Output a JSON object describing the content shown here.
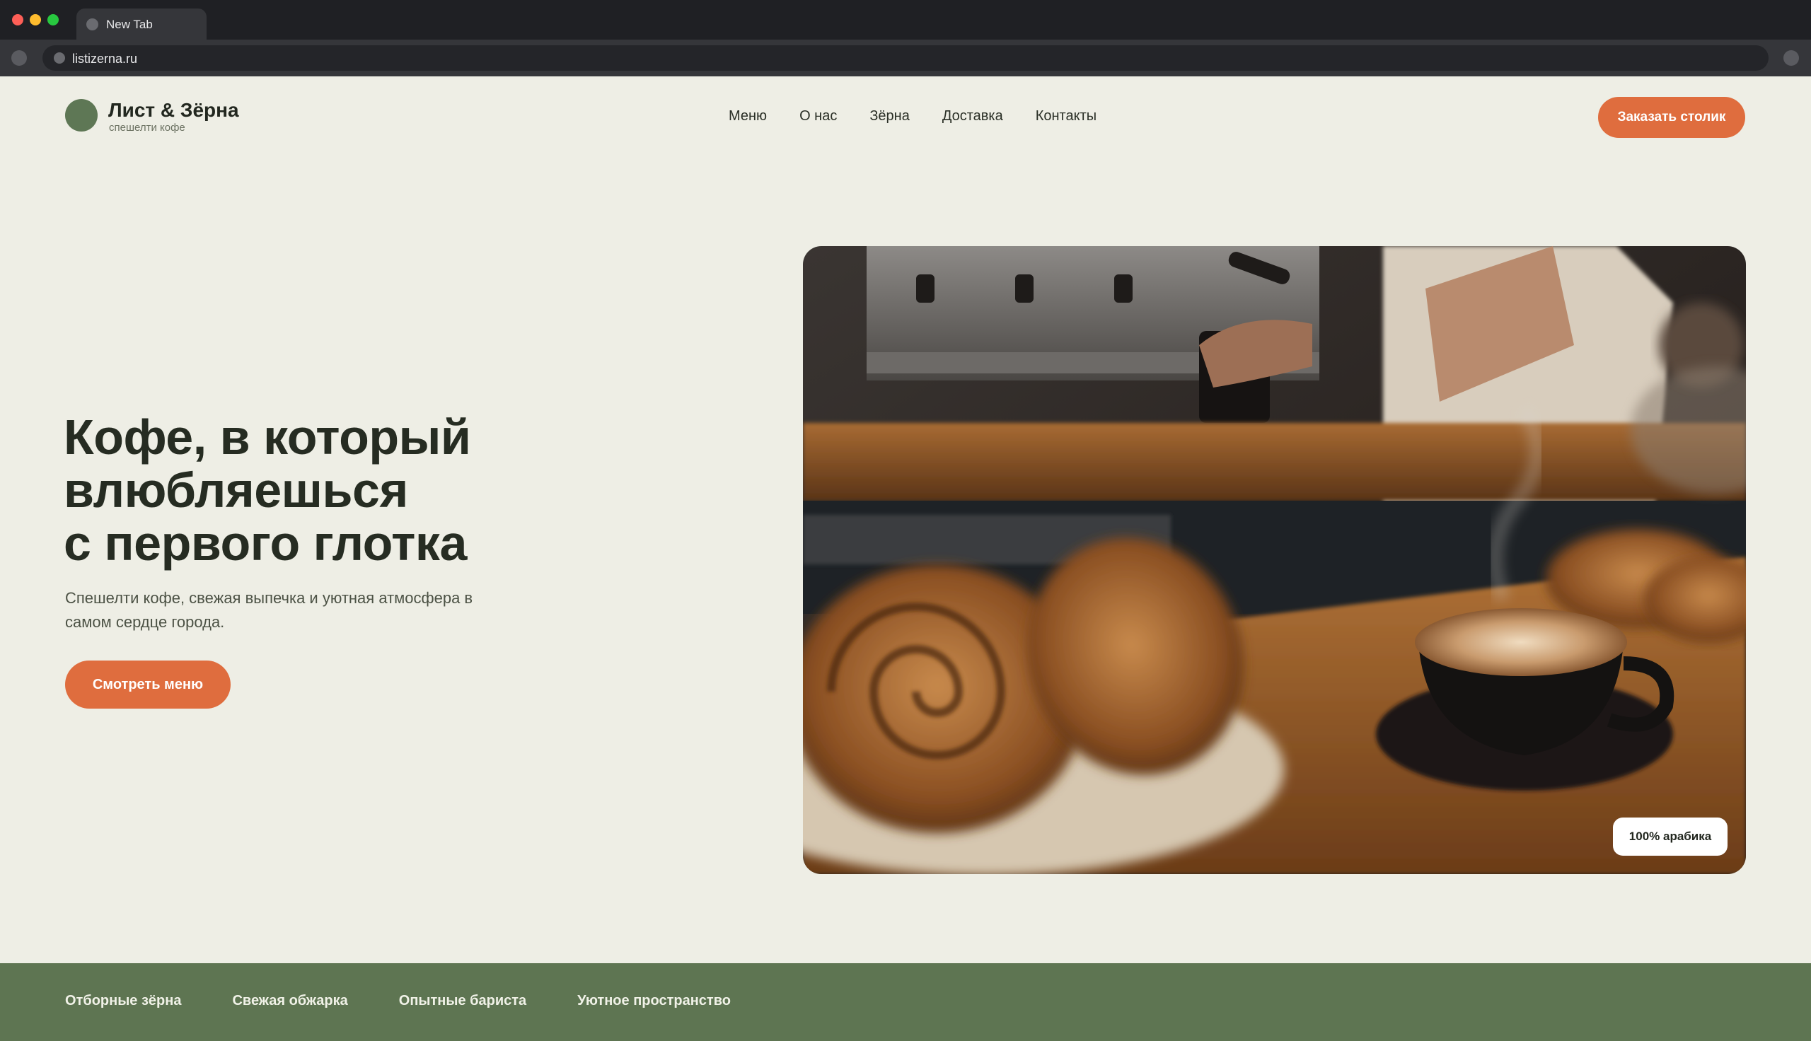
{
  "browser": {
    "tab_title": "New Tab",
    "url": "listizerna.ru"
  },
  "header": {
    "logo_name": "Лист & Зёрна",
    "logo_tagline": "спешелти кофе",
    "nav": [
      "Меню",
      "О нас",
      "Зёрна",
      "Доставка",
      "Контакты"
    ],
    "cta": "Заказать столик"
  },
  "hero": {
    "title_lines": [
      "Кофе, в который",
      "влюбляешься",
      "с первого глотка"
    ],
    "subtitle": "Спешелти кофе, свежая выпечка и уютная атмосфера в самом сердце города.",
    "button": "Смотреть меню",
    "badge": "100% арабика"
  },
  "features": [
    "Отборные зёрна",
    "Свежая обжарка",
    "Опытные бариста",
    "Уютное пространство"
  ],
  "colors": {
    "background": "#eeeee5",
    "accent": "#df6d3e",
    "brand_green": "#5e7552",
    "text_dark": "#262c22"
  }
}
